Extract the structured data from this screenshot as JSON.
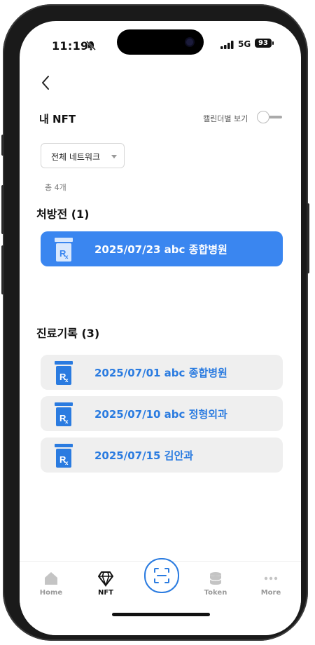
{
  "status_bar": {
    "time": "11:19",
    "network": "5G",
    "battery": "93"
  },
  "header": {
    "title": "내 NFT",
    "calendar_toggle_label": "캘린더별 보기"
  },
  "filter": {
    "selected": "전체 네트워크"
  },
  "summary": {
    "count": "총 4개"
  },
  "prescriptions": {
    "title": "처방전 (1)",
    "items": [
      {
        "label": "2025/07/23 abc 종합병원"
      }
    ]
  },
  "records": {
    "title": "진료기록 (3)",
    "items": [
      {
        "label": "2025/07/01 abc 종합병원"
      },
      {
        "label": "2025/07/10 abc 정형외과"
      },
      {
        "label": "2025/07/15 김안과"
      }
    ]
  },
  "tabbar": {
    "items": [
      {
        "label": "Home",
        "icon": "home-icon"
      },
      {
        "label": "NFT",
        "icon": "diamond-icon"
      },
      {
        "label": "",
        "icon": "scan-icon"
      },
      {
        "label": "Token",
        "icon": "database-icon"
      },
      {
        "label": "More",
        "icon": "more-icon"
      }
    ]
  },
  "colors": {
    "accent": "#3a86f0",
    "link": "#2a7be0",
    "card_gray": "#efefef"
  }
}
